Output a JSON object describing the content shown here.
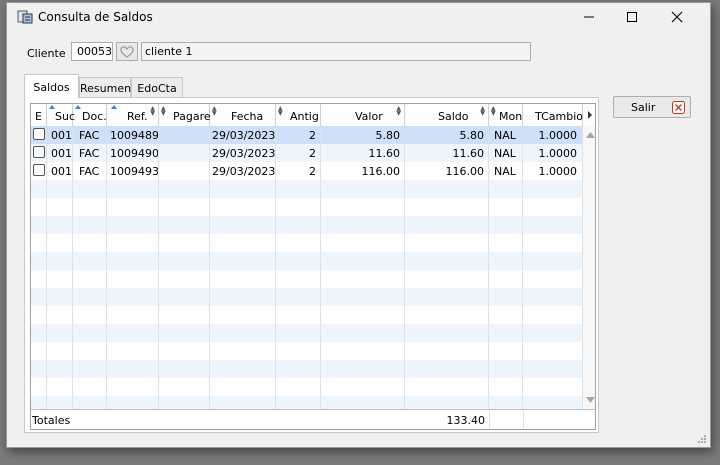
{
  "window": {
    "title": "Consulta de Saldos"
  },
  "client": {
    "label": "Cliente",
    "code": "00053",
    "name": "cliente 1"
  },
  "tabs": [
    "Saldos",
    "Resumen",
    "EdoCta"
  ],
  "grid": {
    "columns": [
      "E",
      "Suc",
      "Doc.",
      "Ref.",
      "Pagare",
      "Fecha",
      "Antig",
      "Valor",
      "Saldo",
      "Mon",
      "TCambio"
    ],
    "rows": [
      {
        "suc": "001",
        "doc": "FAC",
        "ref": "1009489",
        "pagare": "",
        "fecha": "29/03/2023",
        "antig": "2",
        "valor": "5.80",
        "saldo": "5.80",
        "mon": "NAL",
        "tcambio": "1.0000"
      },
      {
        "suc": "001",
        "doc": "FAC",
        "ref": "1009490",
        "pagare": "",
        "fecha": "29/03/2023",
        "antig": "2",
        "valor": "11.60",
        "saldo": "11.60",
        "mon": "NAL",
        "tcambio": "1.0000"
      },
      {
        "suc": "001",
        "doc": "FAC",
        "ref": "1009493",
        "pagare": "",
        "fecha": "29/03/2023",
        "antig": "2",
        "valor": "116.00",
        "saldo": "116.00",
        "mon": "NAL",
        "tcambio": "1.0000"
      }
    ],
    "totals_label": "Totales",
    "totals_saldo": "133.40"
  },
  "buttons": {
    "salir": "Salir"
  },
  "colors": {
    "selected_row": "#cde0f7",
    "alt_row": "#eef5fc",
    "sort_arrow": "#3b7fd4",
    "close_icon": "#c0392b"
  }
}
